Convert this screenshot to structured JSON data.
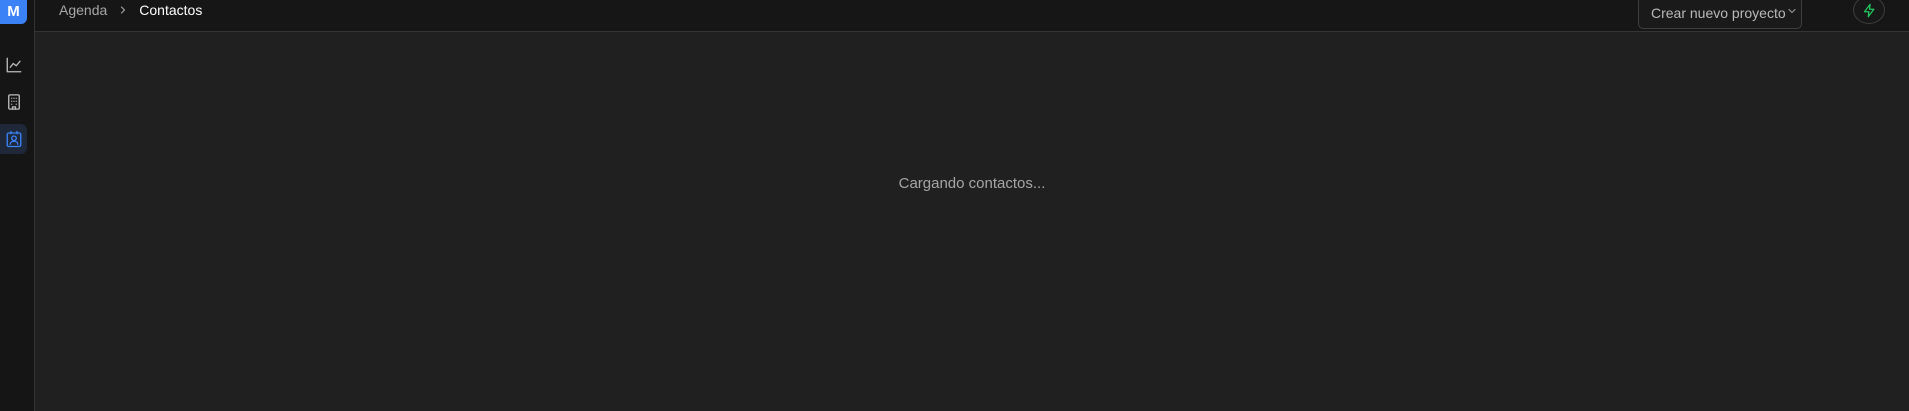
{
  "sidebar": {
    "logo": "M",
    "items": [
      {
        "name": "chart-line-icon",
        "active": false
      },
      {
        "name": "building-icon",
        "active": false
      },
      {
        "name": "contact-card-icon",
        "active": true
      }
    ]
  },
  "header": {
    "breadcrumb": {
      "parent": "Agenda",
      "current": "Contactos"
    },
    "project_select": {
      "label": "Crear nuevo proyecto",
      "icon": "chevron-down-icon"
    },
    "action_button": {
      "icon": "lightning-icon"
    }
  },
  "main": {
    "loading_text": "Cargando contactos..."
  },
  "colors": {
    "accent": "#3b82f6",
    "action_icon": "#22c55e",
    "background": "#202020",
    "sidebar_bg": "#151515"
  }
}
